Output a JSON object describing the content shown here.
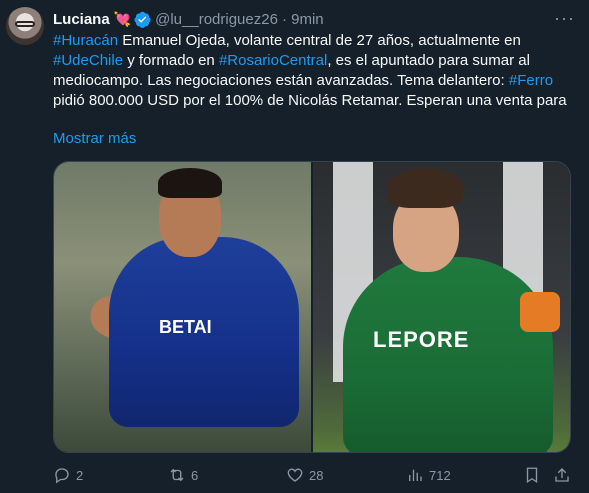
{
  "author": {
    "name": "Luciana",
    "handle": "@lu__rodriguez26",
    "time": "· 9min"
  },
  "tweet": {
    "hash_huracan": "#Huracán",
    "t1": " Emanuel Ojeda, volante central de 27 años, actualmente en ",
    "hash_udechile": "#UdeChile",
    "t2": " y formado en ",
    "hash_rosario": "#RosarioCentral",
    "t3": ", es el apuntado para sumar al mediocampo. Las negociaciones están avanzadas. Tema delantero: ",
    "hash_ferro": "#Ferro",
    "t4": " pidió 800.000 USD por el 100% de Nicolás Retamar. Esperan una venta para",
    "show_more": "Mostrar más"
  },
  "media": {
    "left_sponsor": "BETAI",
    "right_sponsor": "LEPORE"
  },
  "actions": {
    "replies": "2",
    "reposts": "6",
    "likes": "28",
    "views": "712"
  },
  "colors": {
    "background": "#15202b",
    "link": "#1d9bf0",
    "muted": "#8b98a5"
  }
}
